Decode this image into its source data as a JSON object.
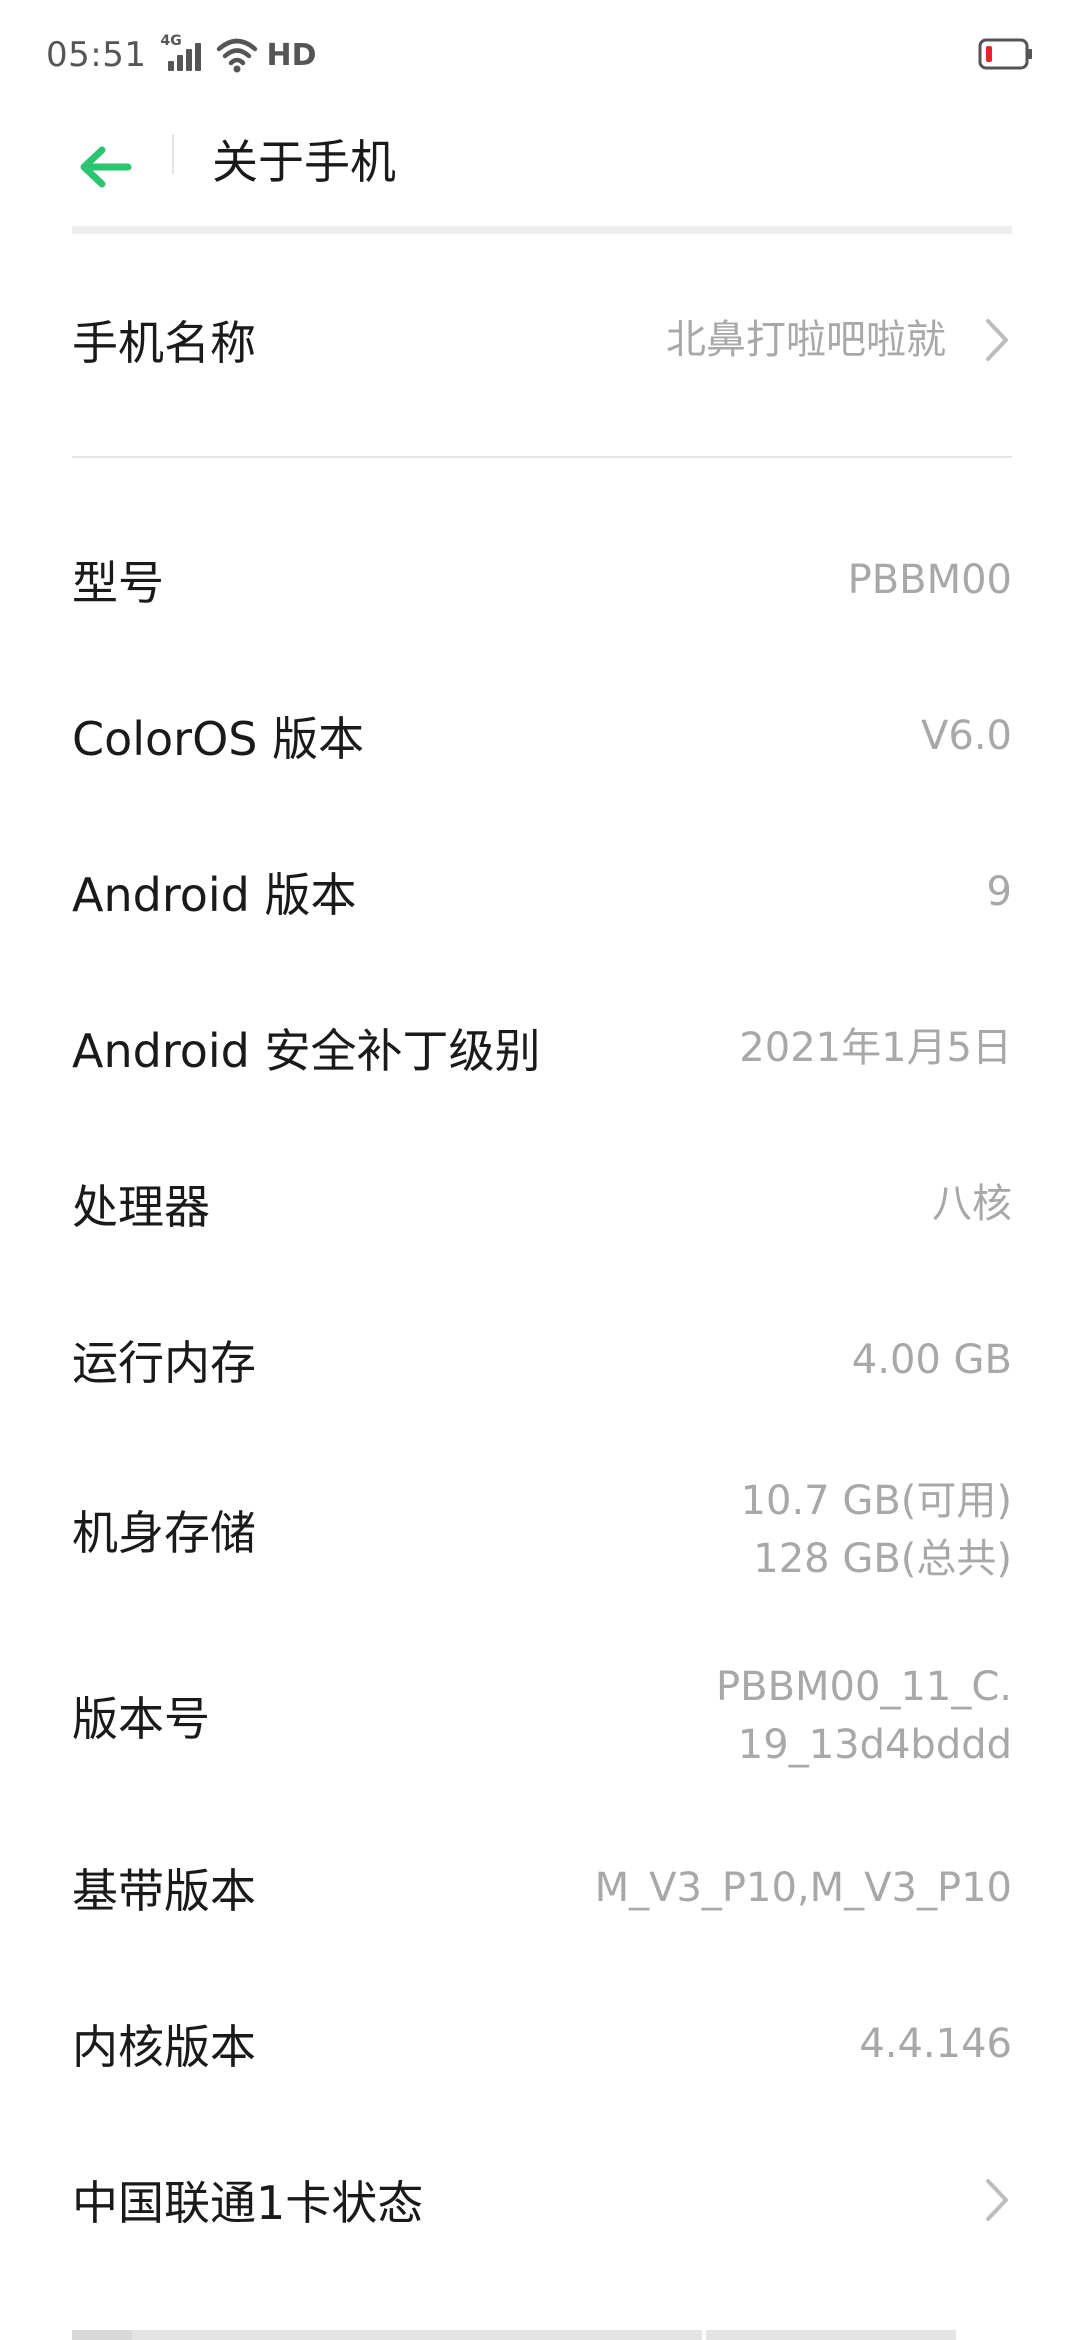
{
  "status_bar": {
    "time": "05:51",
    "network_type": "4G",
    "hd_label": "HD",
    "icons": [
      "signal-icon",
      "wifi-icon",
      "battery-icon"
    ]
  },
  "header": {
    "title": "关于手机",
    "accent_color": "#2bc46f"
  },
  "rows": {
    "phone_name": {
      "label": "手机名称",
      "value": "北鼻打啦吧啦就"
    },
    "model": {
      "label": "型号",
      "value": "PBBM00"
    },
    "coloros_version": {
      "label": "ColorOS 版本",
      "value": "V6.0"
    },
    "android_version": {
      "label": "Android 版本",
      "value": "9"
    },
    "security_patch": {
      "label": "Android 安全补丁级别",
      "value": "2021年1月5日"
    },
    "processor": {
      "label": "处理器",
      "value": "八核"
    },
    "ram": {
      "label": "运行内存",
      "value": "4.00 GB"
    },
    "storage": {
      "label": "机身存储",
      "value_line1": "10.7 GB(可用)",
      "value_line2": "128 GB(总共)"
    },
    "build_number": {
      "label": "版本号",
      "value_line1": "PBBM00_11_C.",
      "value_line2": "19_13d4bddd"
    },
    "baseband": {
      "label": "基带版本",
      "value": "M_V3_P10,M_V3_P10"
    },
    "kernel": {
      "label": "内核版本",
      "value": "4.4.146"
    },
    "sim1_status": {
      "label": "中国联通1卡状态"
    }
  }
}
